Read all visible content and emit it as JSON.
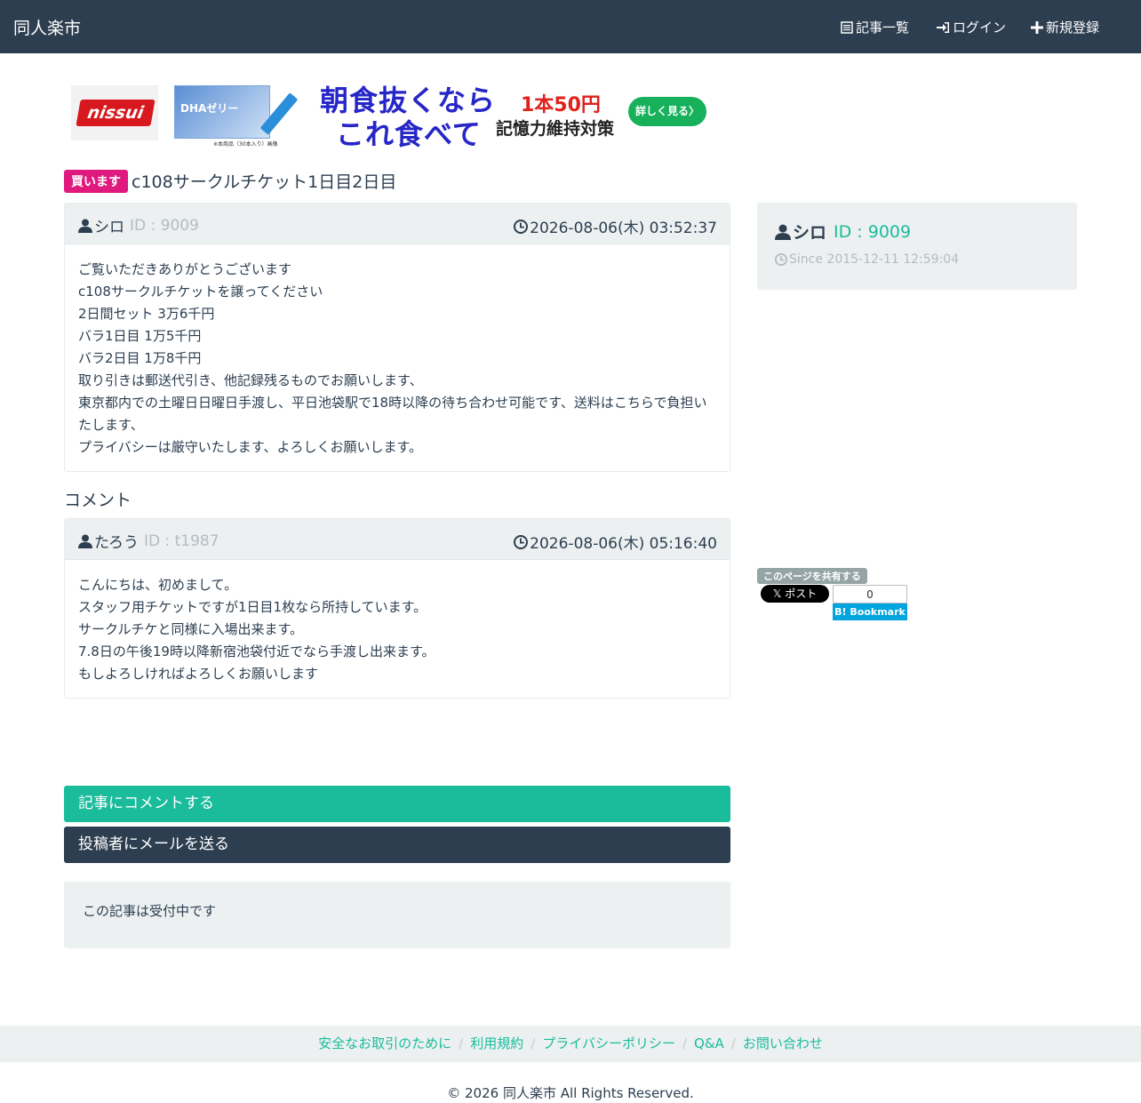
{
  "navbar": {
    "brand": "同人楽市",
    "articles": "記事一覧",
    "login": "ログイン",
    "register": "新規登録"
  },
  "banner": {
    "logo": "nissui",
    "product": "DHAゼリー",
    "note": "※本商品（30本入り）画像",
    "headline1": "朝食抜くなら",
    "headline2": "これ食べて",
    "price": "1本50円",
    "sub": "記憶力維持対策",
    "cta": "詳しく見る〉"
  },
  "post": {
    "badge": "買います",
    "title": "c108サークルチケット1日目2日目",
    "author": "シロ",
    "id_label": "ID : 9009",
    "datetime": "2026-08-06(木) 03:52:37",
    "lines": [
      "ご覧いただきありがとうございます",
      "c108サークルチケットを譲ってください",
      "2日間セット 3万6千円",
      "バラ1日目 1万5千円",
      "バラ2日目 1万8千円",
      "取り引きは郵送代引き、他記録残るものでお願いします、",
      "東京都内での土曜日日曜日手渡し、平日池袋駅で18時以降の待ち合わせ可能です、送料はこちらで負担い",
      "たします、",
      "プライバシーは厳守いたします、よろしくお願いします。"
    ]
  },
  "comments": {
    "heading": "コメント",
    "items": [
      {
        "author": "たろう",
        "id_label": "ID : t1987",
        "datetime": "2026-08-06(木) 05:16:40",
        "lines": [
          "こんにちは、初めまして。",
          "スタッフ用チケットですが1日目1枚なら所持しています。",
          "サークルチケと同様に入場出来ます。",
          "7.8日の午後19時以降新宿池袋付近でなら手渡し出来ます。",
          "もしよろしければよろしくお願いします"
        ]
      }
    ]
  },
  "actions": {
    "comment": "記事にコメントする",
    "mail": "投稿者にメールを送る"
  },
  "status": "この記事は受付中です",
  "profile": {
    "name": "シロ",
    "id_label": "ID : 9009",
    "since": "Since 2015-12-11 12:59:04"
  },
  "share": {
    "label": "このページを共有する",
    "xpost": "ポスト",
    "hatena_count": "0",
    "hatena_label": "B! Bookmark"
  },
  "footer": {
    "links": [
      "安全なお取引のために",
      "利用規約",
      "プライバシーポリシー",
      "Q&A",
      "お問い合わせ"
    ],
    "copyright": "© 2026 同人楽市 All Rights Reserved."
  }
}
